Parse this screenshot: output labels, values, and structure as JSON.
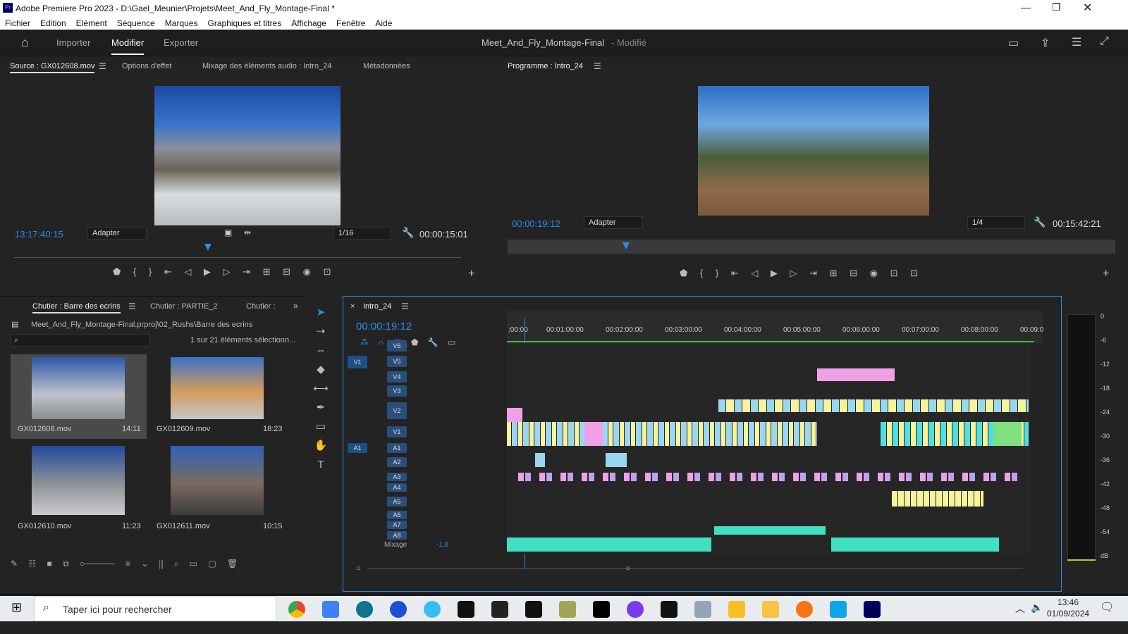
{
  "window": {
    "title": "Adobe Premiere Pro 2023 - D:\\Gael_Meunier\\Projets\\Meet_And_Fly_Montage-Final *"
  },
  "menu": [
    "Fichier",
    "Edition",
    "Elément",
    "Séquence",
    "Marques",
    "Graphiques et titres",
    "Affichage",
    "Fenêtre",
    "Aide"
  ],
  "workspace": {
    "tabs": [
      "Importer",
      "Modifier",
      "Exporter"
    ],
    "project": "Meet_And_Fly_Montage-Final",
    "status": "- Modifié"
  },
  "source": {
    "tabs": [
      "Source : GX012608.mov",
      "Options d'effet",
      "Mixage des éléments audio : Intro_24",
      "Métadonnées"
    ],
    "timecode": "13:17:40:15",
    "fit": "Adapter",
    "res": "1/16",
    "duration": "00:00:15:01"
  },
  "program": {
    "tab": "Programme : Intro_24",
    "timecode": "00:00:19:12",
    "fit": "Adapter",
    "res": "1/4",
    "duration": "00:15:42:21"
  },
  "bin": {
    "tabs": [
      "Chutier : Barre des ecrins",
      "Chutier : PARTIE_2",
      "Chutier :"
    ],
    "path": "Meet_And_Fly_Montage-Final.prproj\\02_Rushs\\Barre des ecrins",
    "selection": "1 sur 21 éléments sélectionn...",
    "items": [
      {
        "name": "GX012608.mov",
        "dur": "14:11"
      },
      {
        "name": "GX012609.mov",
        "dur": "18:23"
      },
      {
        "name": "GX012610.mov",
        "dur": "11:23"
      },
      {
        "name": "GX012611.mov",
        "dur": "10:15"
      }
    ]
  },
  "timeline": {
    "tab": "Intro_24",
    "timecode": "00:00:19:12",
    "ruler": [
      ":00:00",
      "00:01:00:00",
      "00:02:00:00",
      "00:03:00:00",
      "00:04:00:00",
      "00:05:00:00",
      "00:06:00:00",
      "00:07:00:00",
      "00:08:00:00",
      "00:09:0"
    ],
    "vtracks": [
      "V6",
      "V5",
      "V4",
      "V3",
      "V2",
      "V1"
    ],
    "atracks": [
      "A1",
      "A2",
      "A3",
      "A4",
      "A5",
      "A6",
      "A7",
      "A8"
    ],
    "mix_label": "Mixage",
    "mix_value": "-1,8",
    "src_v": "V1",
    "src_a": "A1"
  },
  "meter": {
    "ticks": [
      "0",
      "-6",
      "-12",
      "-18",
      "-24",
      "-30",
      "-36",
      "-42",
      "-48",
      "-54",
      "dB"
    ]
  },
  "taskbar": {
    "search": "Taper ici pour rechercher",
    "time": "13:46",
    "date": "01/09/2024"
  }
}
